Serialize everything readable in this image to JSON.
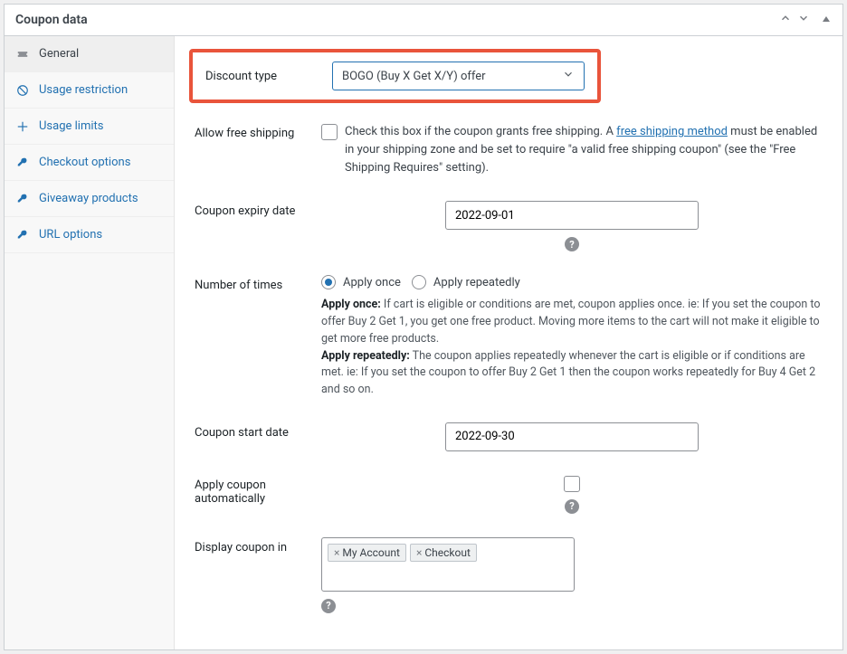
{
  "header": {
    "title": "Coupon data"
  },
  "sidebar": {
    "items": [
      {
        "label": "General"
      },
      {
        "label": "Usage restriction"
      },
      {
        "label": "Usage limits"
      },
      {
        "label": "Checkout options"
      },
      {
        "label": "Giveaway products"
      },
      {
        "label": "URL options"
      }
    ]
  },
  "main": {
    "discount_type": {
      "label": "Discount type",
      "selected_value": "BOGO (Buy X Get X/Y) offer"
    },
    "allow_free_shipping": {
      "label": "Allow free shipping",
      "checked": false,
      "desc_prefix": "Check this box if the coupon grants free shipping. A ",
      "desc_link": "free shipping method",
      "desc_suffix": " must be enabled in your shipping zone and be set to require \"a valid free shipping coupon\" (see the \"Free Shipping Requires\" setting)."
    },
    "coupon_expiry": {
      "label": "Coupon expiry date",
      "value": "2022-09-01"
    },
    "number_of_times": {
      "label": "Number of times",
      "option_once": "Apply once",
      "option_repeat": "Apply repeatedly",
      "selected": "once",
      "help_once_label": "Apply once:",
      "help_once_text": " If cart is eligible or conditions are met, coupon applies once. ie: If you set the coupon to offer Buy 2 Get 1, you get one free product. Moving more items to the cart will not make it eligible to get more free products.",
      "help_repeat_label": "Apply repeatedly:",
      "help_repeat_text": " The coupon applies repeatedly whenever the cart is eligible or if conditions are met. ie: If you set the coupon to offer Buy 2 Get 1 then the coupon works repeatedly for Buy 4 Get 2 and so on."
    },
    "coupon_start": {
      "label": "Coupon start date",
      "value": "2022-09-30"
    },
    "auto_apply": {
      "label": "Apply coupon automatically",
      "checked": false
    },
    "display_in": {
      "label": "Display coupon in",
      "tags": [
        "My Account",
        "Checkout"
      ]
    }
  },
  "tooltips": {
    "q": "?"
  }
}
